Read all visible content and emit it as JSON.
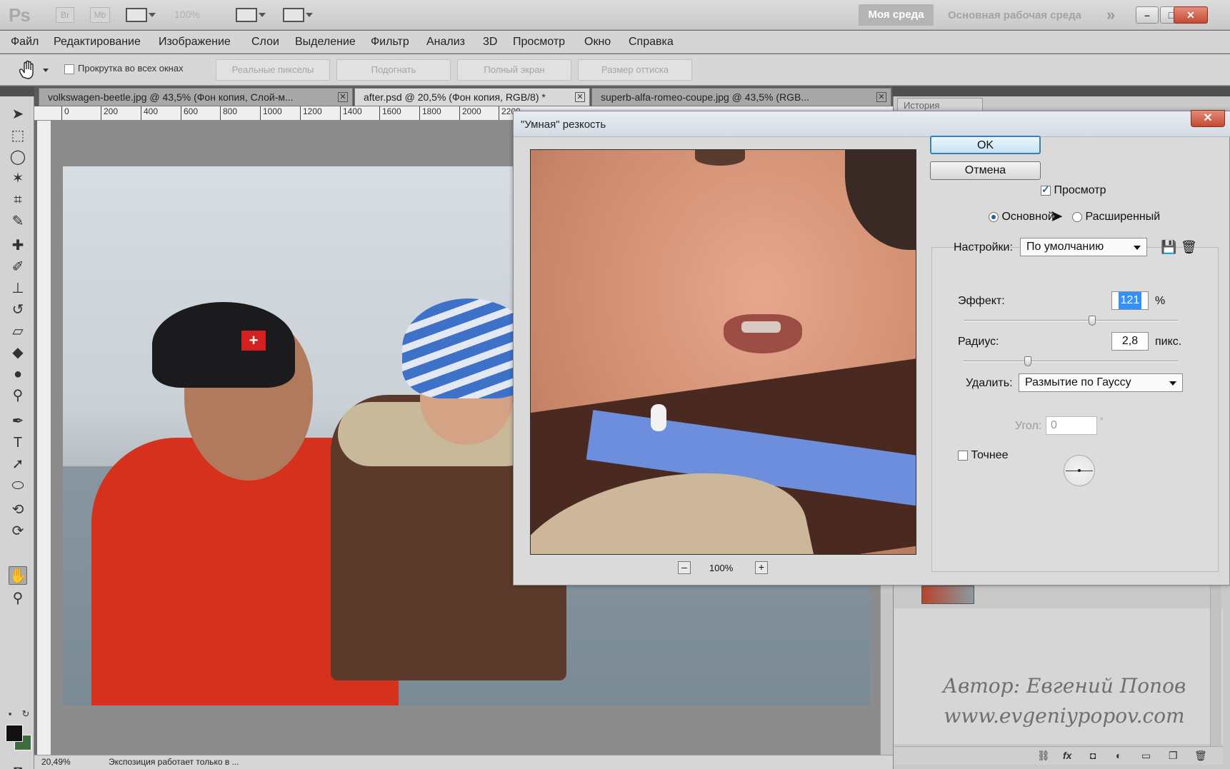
{
  "app": {
    "logo": "Ps",
    "bridge_label": "Br",
    "mini_bridge_label": "Mb",
    "zoom_level": "100%",
    "workspace_active": "Моя среда",
    "workspace_main": "Основная рабочая среда",
    "workspace_more": "»",
    "minimize": "–",
    "maximize": "□",
    "close": "✕"
  },
  "menu": [
    "Файл",
    "Редактирование",
    "Изображение",
    "Слои",
    "Выделение",
    "Фильтр",
    "Анализ",
    "3D",
    "Просмотр",
    "Окно",
    "Справка"
  ],
  "options": {
    "scroll_all_windows": "Прокрутка во всех окнах",
    "actual_pixels": "Реальные пикселы",
    "fit_screen": "Подогнать",
    "fill_screen": "Полный экран",
    "print_size": "Размер оттиска"
  },
  "tabs": [
    {
      "label": "volkswagen-beetle.jpg @ 43,5% (Фон копия, Слой-м...",
      "active": false
    },
    {
      "label": "after.psd @ 20,5% (Фон копия, RGB/8) *",
      "active": true
    },
    {
      "label": "superb-alfa-romeo-coupe.jpg @ 43,5% (RGB...",
      "active": false
    }
  ],
  "ruler_ticks": [
    "0",
    "200",
    "400",
    "600",
    "800",
    "1000",
    "1200",
    "1400",
    "1600",
    "1800",
    "2000",
    "2200"
  ],
  "status": {
    "zoom": "20,49%",
    "text": "Экспозиция работает только в ..."
  },
  "panels": {
    "history_tab": "История",
    "watermark_line1": "Автор: Евгений Попов",
    "watermark_line2": "www.evgeniypopov.com"
  },
  "dialog": {
    "title": "\"Умная\" резкость",
    "close": "✕",
    "ok": "OK",
    "cancel": "Отмена",
    "preview_label": "Просмотр",
    "preview_checked": true,
    "mode_basic": "Основной",
    "mode_advanced": "Расширенный",
    "mode_selected": "basic",
    "settings_label": "Настройки:",
    "settings_value": "По умолчанию",
    "amount_label": "Эффект:",
    "amount_value": "121",
    "amount_unit": "%",
    "amount_slider_fraction": 0.6,
    "radius_label": "Радиус:",
    "radius_value": "2,8",
    "radius_unit": "пикс.",
    "radius_slider_fraction": 0.3,
    "remove_label": "Удалить:",
    "remove_value": "Размытие по Гауссу",
    "angle_label": "Угол:",
    "angle_value": "0",
    "angle_unit": "°",
    "more_accurate_label": "Точнее",
    "more_accurate_checked": false,
    "preview_zoom": "100%",
    "zoom_out": "–",
    "zoom_in": "+"
  },
  "colors": {
    "foreground": "#111111",
    "background": "#3d6a3e",
    "accent": "#3c7fb1"
  }
}
